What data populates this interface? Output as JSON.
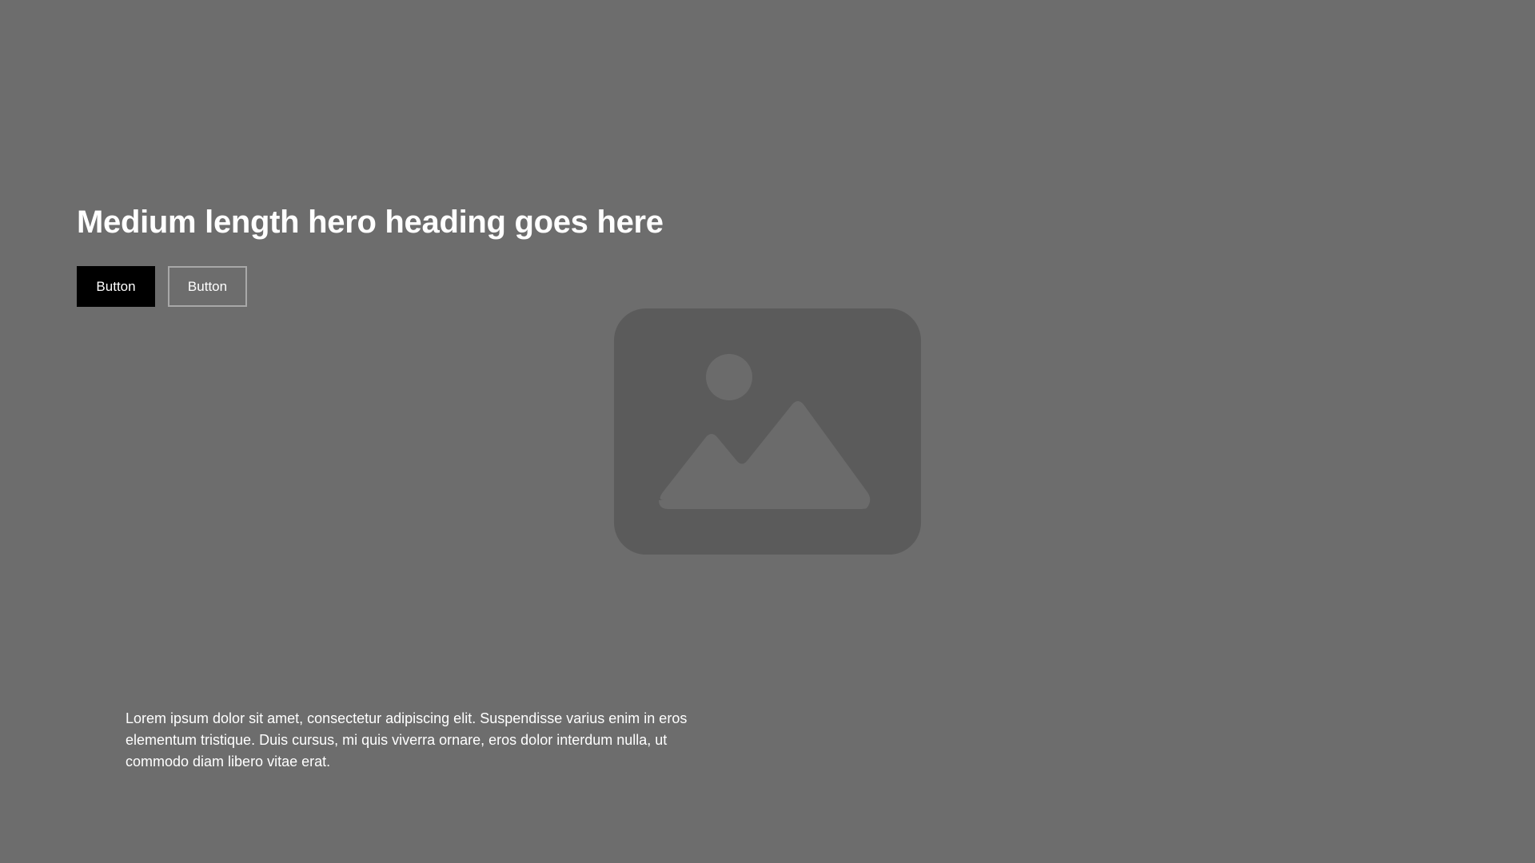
{
  "hero": {
    "heading": "Medium length hero heading goes here",
    "primary_button_label": "Button",
    "secondary_button_label": "Button",
    "body_text": "Lorem ipsum dolor sit amet, consectetur adipiscing elit. Suspendisse varius enim in eros elementum tristique. Duis cursus, mi quis viverra ornare, eros dolor interdum nulla, ut commodo diam libero vitae erat."
  },
  "image": {
    "icon": "image-placeholder-icon"
  },
  "colors": {
    "background": "#6d6d6d",
    "primary_button_bg": "#000000",
    "secondary_button_border": "#a8a8a8",
    "placeholder_frame": "#5b5b5b",
    "placeholder_glyph": "#6b6b6b"
  }
}
